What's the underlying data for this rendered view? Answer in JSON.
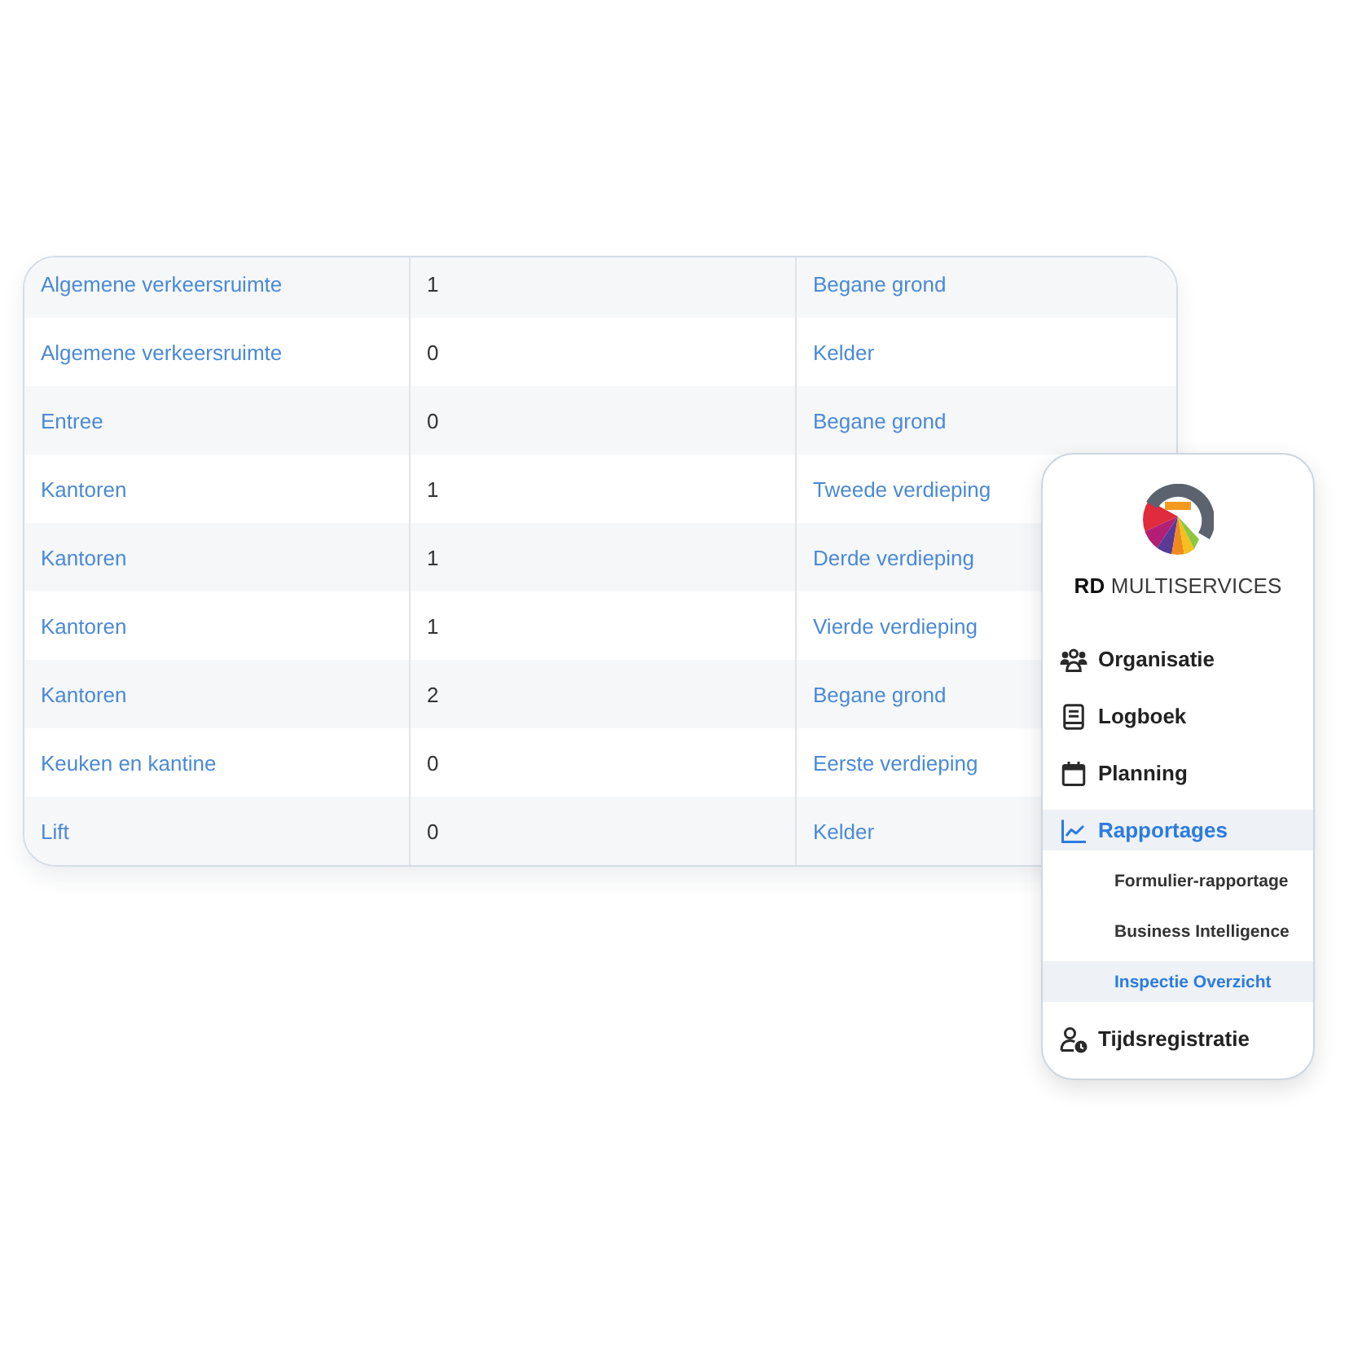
{
  "table": {
    "rows": [
      {
        "cells": [
          "Algemene verkeersruimte",
          "1",
          "Begane grond"
        ]
      },
      {
        "cells": [
          "Algemene verkeersruimte",
          "0",
          "Kelder"
        ]
      },
      {
        "cells": [
          "Entree",
          "0",
          "Begane grond"
        ]
      },
      {
        "cells": [
          "Kantoren",
          "1",
          "Tweede verdieping"
        ]
      },
      {
        "cells": [
          "Kantoren",
          "1",
          "Derde verdieping"
        ]
      },
      {
        "cells": [
          "Kantoren",
          "1",
          "Vierde verdieping"
        ]
      },
      {
        "cells": [
          "Kantoren",
          "2",
          "Begane grond"
        ]
      },
      {
        "cells": [
          "Keuken en kantine",
          "0",
          "Eerste verdieping"
        ]
      },
      {
        "cells": [
          "Lift",
          "0",
          "Kelder"
        ]
      }
    ]
  },
  "sidebar": {
    "brand": "**RD** MULTISERVICES",
    "items": [
      {
        "label": "Organisatie",
        "selected": false
      },
      {
        "label": "Logboek",
        "selected": false
      },
      {
        "label": "Planning",
        "selected": false
      },
      {
        "label": "Rapportages",
        "selected": true,
        "expanded": true,
        "children": [
          {
            "label": "Formulier-rapportage",
            "selected": false
          },
          {
            "label": "Business Intelligence",
            "selected": false
          },
          {
            "label": "Inspectie Overzicht",
            "selected": true
          }
        ]
      },
      {
        "label": "Tijdsregistratie",
        "selected": false
      }
    ]
  }
}
